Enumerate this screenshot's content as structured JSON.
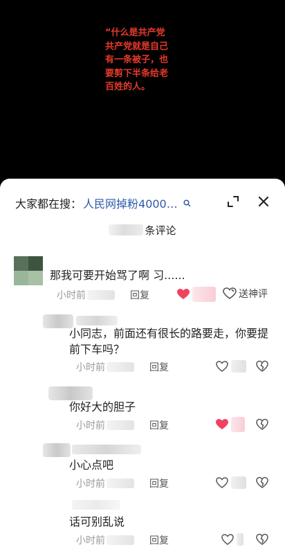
{
  "video": {
    "caption": "“什么是共产党\n共产党就是自己\n有一条被子，也\n要剪下半条给老\n百姓的人。"
  },
  "comments_panel": {
    "search_prefix": "大家都在搜：",
    "search_term": "人民网掉粉4000…",
    "count_label": "条评论",
    "reply_label": "回复",
    "time_label": "小时前",
    "hot_review_label": "送神评",
    "colors": {
      "liked": "#f0445e",
      "link": "#2d5aa8",
      "caption": "#e8392b"
    }
  },
  "comments": [
    {
      "text": "那我可要开始骂了啊 习......",
      "liked": true
    },
    {
      "text": "小同志，前面还有很长的路要走，你要提前下车吗？",
      "liked": false
    },
    {
      "text": "你好大的胆子",
      "liked": true
    },
    {
      "text": "小心点吧",
      "liked": false
    },
    {
      "text": "话可别乱说",
      "liked": false
    }
  ]
}
